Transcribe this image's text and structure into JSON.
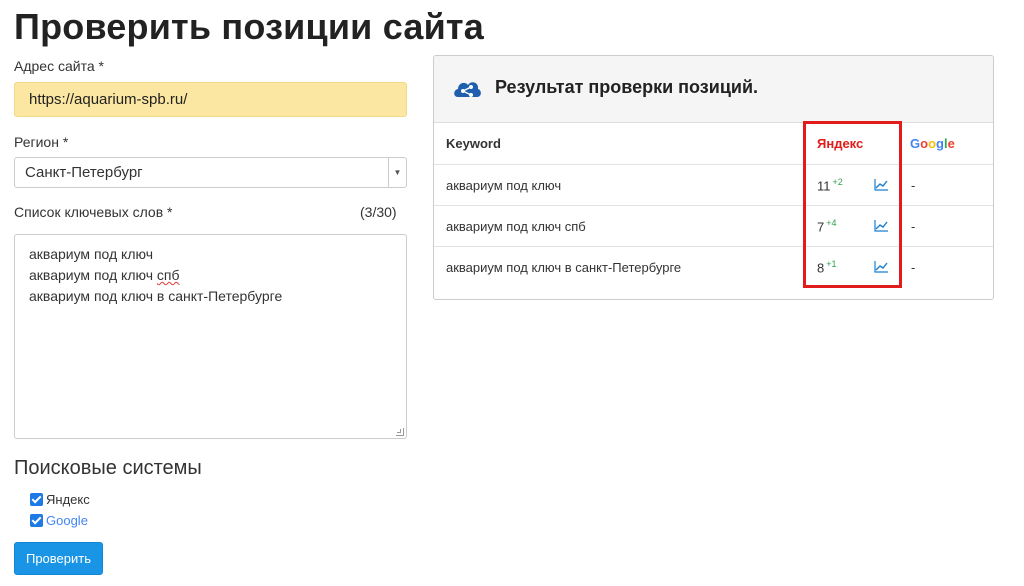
{
  "page": {
    "title": "Проверить позиции сайта"
  },
  "form": {
    "url_label": "Адрес сайта *",
    "url_value": "https://aquarium-spb.ru/",
    "region_label": "Регион *",
    "region_value": "Санкт-Петербург",
    "keywords_label": "Список ключевых слов *",
    "keywords_counter": "(3/30)",
    "keywords": {
      "line1": "аквариум под ключ",
      "line2_prefix": "аквариум под ключ ",
      "line2_flagged": "спб",
      "line3": "аквариум под ключ в санкт-Петербурге"
    },
    "engines_heading": "Поисковые системы",
    "engines": [
      {
        "label": "Яндекс",
        "checked": true
      },
      {
        "label": "Google",
        "checked": true
      }
    ],
    "submit_label": "Проверить"
  },
  "results": {
    "title": "Результат проверки позиций.",
    "columns": {
      "keyword": "Keyword",
      "yandex": "Яндекс",
      "google": "Google"
    },
    "rows": [
      {
        "keyword": "аквариум под ключ",
        "yandex_pos": "11",
        "yandex_delta": "+2",
        "google_pos": "-"
      },
      {
        "keyword": "аквариум под ключ спб",
        "yandex_pos": "7",
        "yandex_delta": "+4",
        "google_pos": "-"
      },
      {
        "keyword": "аквариум под ключ в санкт-Петербурге",
        "yandex_pos": "8",
        "yandex_delta": "+1",
        "google_pos": "-"
      }
    ]
  },
  "colors": {
    "url_field_bg": "#fbe7a1",
    "primary_button": "#1a95e6",
    "highlight_border": "#e21b1b",
    "delta_positive": "#2e9e4f",
    "yandex_red": "#e21b1b"
  },
  "icons": {
    "panel": "share-icon",
    "row_action": "trend-chart-icon"
  }
}
